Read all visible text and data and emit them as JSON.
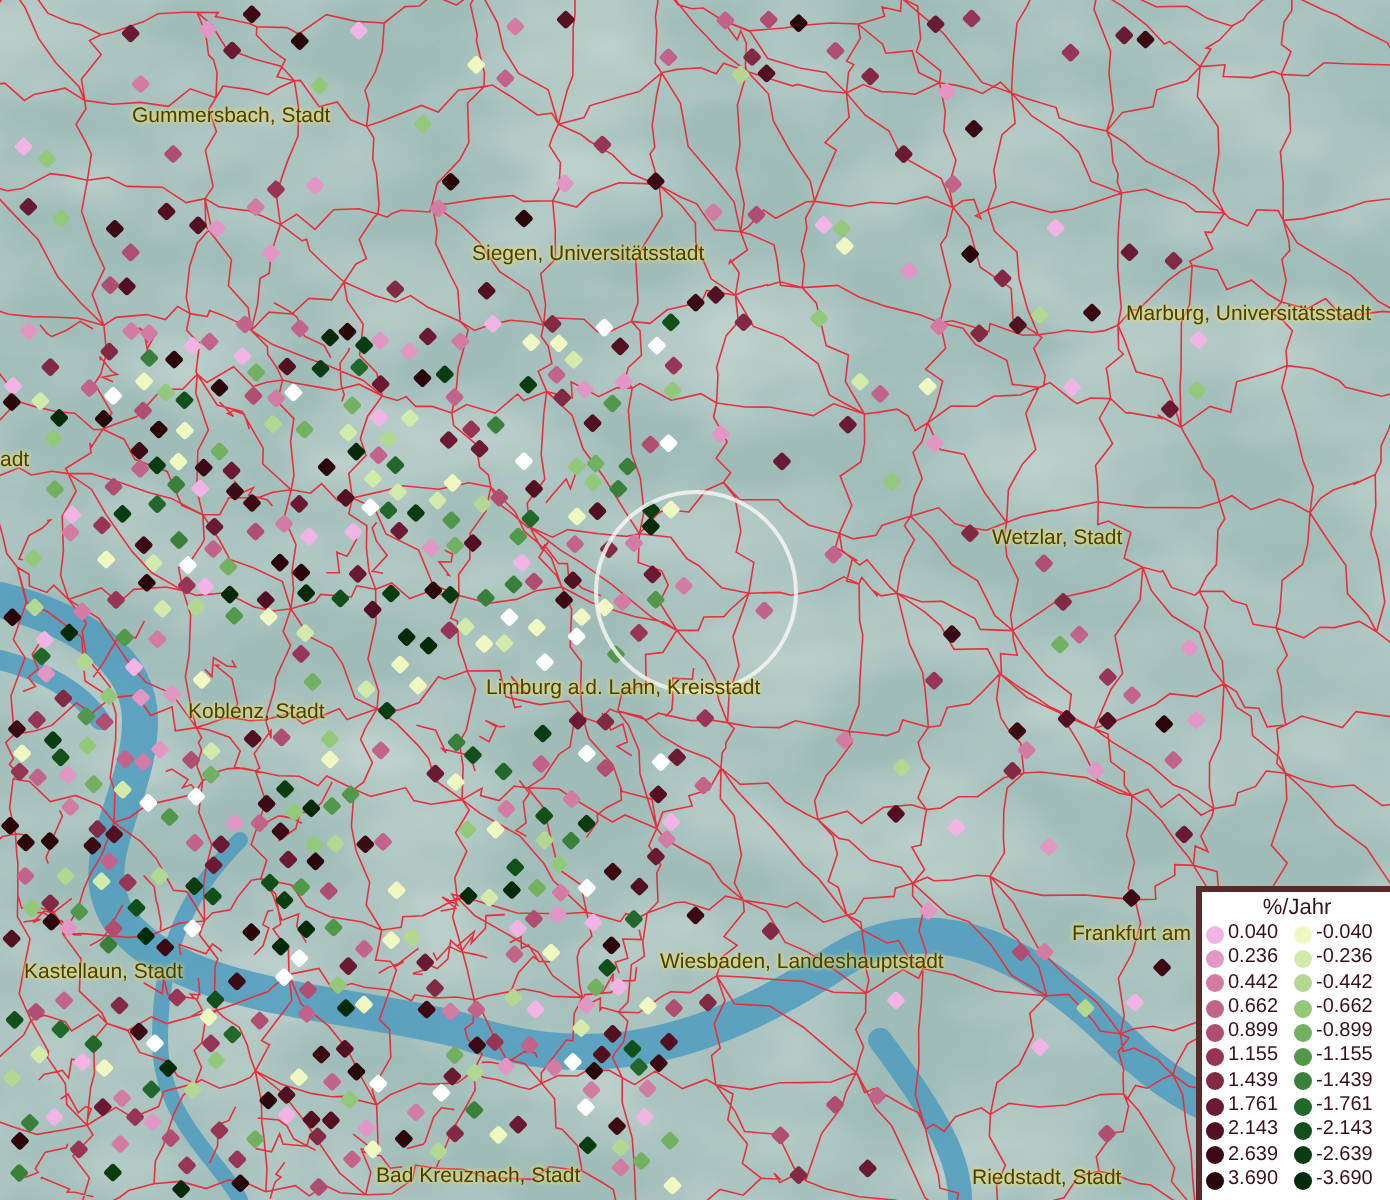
{
  "map": {
    "place_labels": [
      "Gummersbach, Stadt",
      "Siegen, Universitätsstadt",
      "Marburg, Universitätsstadt",
      "adt",
      "Wetzlar, Stadt",
      "Limburg a.d. Lahn, Kreisstadt",
      "Koblenz, Stadt",
      "Kastellaun, Stadt",
      "Wiesbaden, Landeshauptstadt",
      "Frankfurt am",
      "Bad Kreuznach, Stadt",
      "Riedstadt, Stadt"
    ]
  },
  "legend": {
    "title": "%/Jahr",
    "positive": [
      {
        "label": "0.040",
        "color": "#f2b4e4"
      },
      {
        "label": "0.236",
        "color": "#e296c4"
      },
      {
        "label": "0.442",
        "color": "#d27ca4"
      },
      {
        "label": "0.662",
        "color": "#c2648a"
      },
      {
        "label": "0.899",
        "color": "#b04e72"
      },
      {
        "label": "1.155",
        "color": "#983456"
      },
      {
        "label": "1.439",
        "color": "#822a44"
      },
      {
        "label": "1.761",
        "color": "#6a1a32"
      },
      {
        "label": "2.143",
        "color": "#521022"
      },
      {
        "label": "2.639",
        "color": "#3c0a14"
      },
      {
        "label": "3.690",
        "color": "#2a050a"
      }
    ],
    "negative": [
      {
        "label": "-0.040",
        "color": "#f0f8c2"
      },
      {
        "label": "-0.236",
        "color": "#d2eaaa"
      },
      {
        "label": "-0.442",
        "color": "#b2d892"
      },
      {
        "label": "-0.662",
        "color": "#92c87a"
      },
      {
        "label": "-0.899",
        "color": "#72b062"
      },
      {
        "label": "-1.155",
        "color": "#52984a"
      },
      {
        "label": "-1.439",
        "color": "#3a803a"
      },
      {
        "label": "-1.761",
        "color": "#22682a"
      },
      {
        "label": "-2.143",
        "color": "#12501a"
      },
      {
        "label": "-2.639",
        "color": "#0a3c12"
      },
      {
        "label": "-3.690",
        "color": "#052a0a"
      }
    ]
  }
}
